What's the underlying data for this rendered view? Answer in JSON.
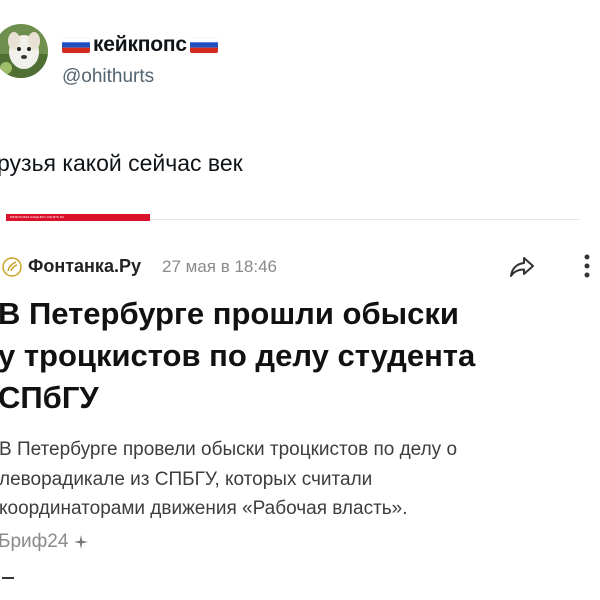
{
  "tweet": {
    "display_name": "кейкпопс",
    "handle": "@ohithurts",
    "text": "рузья какой сейчас век",
    "flag_icon": "russian-flag-icon"
  },
  "embedded_article": {
    "top_strip_text": "БИЛЕТЫ БЕЗ НАЦЕНКИ LIVE.MTS.RU",
    "source_name": "Фонтанка.Ру",
    "published": "27 мая в 18:46",
    "headline_lines": [
      "В Петербурге прошли обыски",
      "у троцкистов по делу студента",
      "СПбГУ"
    ],
    "snippet_lines": [
      "В Петербурге провели обыски троцкистов по делу о",
      "леворадикале из СПБГУ, которых считали",
      "координаторами движения «Рабочая власть»."
    ],
    "brief_label": "Бриф24",
    "icons": [
      "fontanka-logo-icon",
      "share-icon",
      "more-vertical-icon",
      "sparkle-icon"
    ],
    "colors": {
      "strip": "#d9112a",
      "source_text": "#222222",
      "meta_text": "#8a8a8a"
    }
  }
}
